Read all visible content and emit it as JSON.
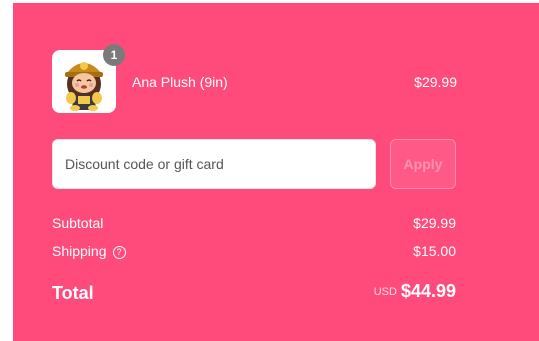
{
  "colors": {
    "panel_bg": "#ff4b7b",
    "text": "#ffffff",
    "apply_text": "#ff94b1",
    "badge_bg": "#7a7a7a"
  },
  "line_item": {
    "thumbnail_icon": "ana-plush-image",
    "quantity": "1",
    "name": "Ana Plush (9in)",
    "price": "$29.99"
  },
  "discount": {
    "placeholder": "Discount code or gift card",
    "apply_label": "Apply"
  },
  "summary": {
    "subtotal_label": "Subtotal",
    "subtotal_value": "$29.99",
    "shipping_label": "Shipping",
    "shipping_help_icon": "question-circle-icon",
    "shipping_value": "$15.00",
    "total_label": "Total",
    "currency": "USD",
    "total_value": "$44.99"
  }
}
